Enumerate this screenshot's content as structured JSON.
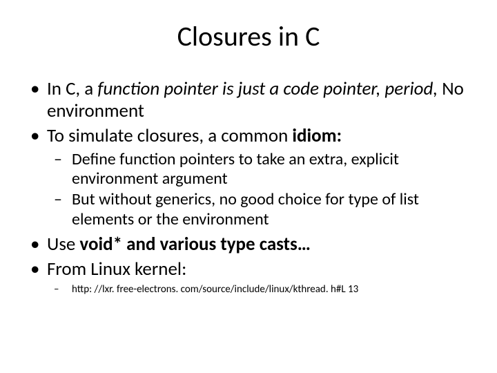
{
  "title": "Closures in C",
  "bullets": {
    "b1_pre": "In C, a ",
    "b1_italic": "function pointer is just a code pointer, period,",
    "b1_post": " No environment",
    "b2_pre": "To simulate closures, a common ",
    "b2_bold": "idiom:",
    "b2_sub1": "Define function pointers to take an extra, explicit environment argument",
    "b2_sub2": "But without generics, no good choice for type of list elements or the environment",
    "b3_pre": "Use ",
    "b3_bold": "void* and various type casts…",
    "b4": "From Linux kernel:",
    "b4_sub1": "http: //lxr. free-electrons. com/source/include/linux/kthread. h#L 13"
  }
}
